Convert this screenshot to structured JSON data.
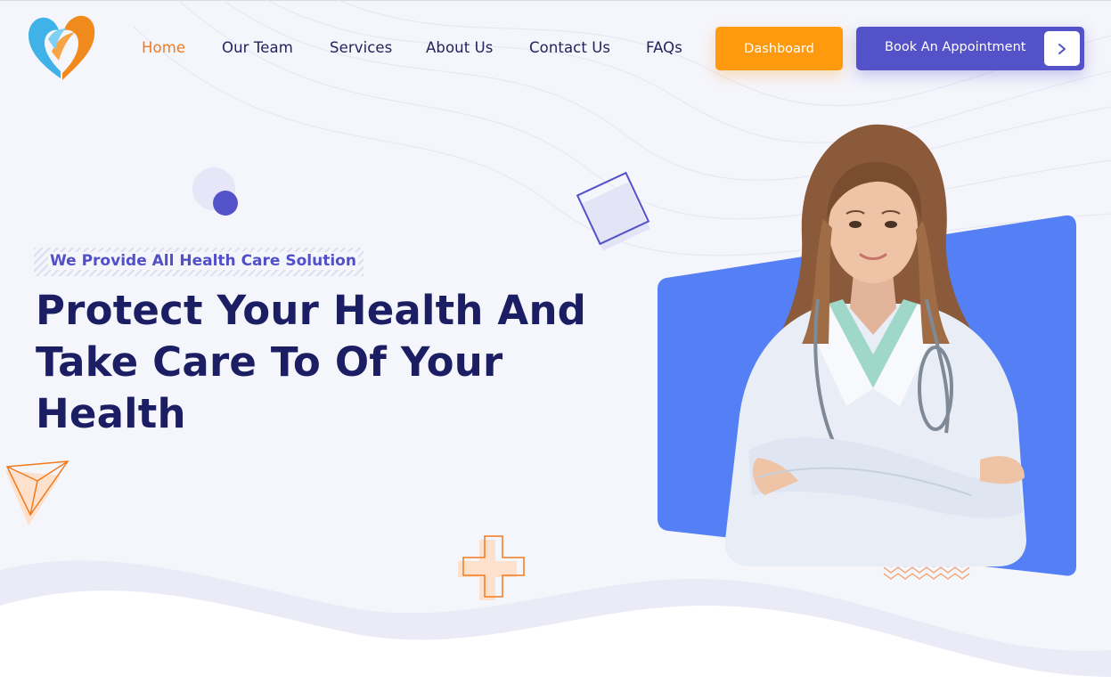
{
  "brand": {
    "logo_icon": "heart-logo-icon",
    "colors": {
      "blue": "#3fb3e8",
      "orange": "#f08a1c"
    }
  },
  "nav": {
    "items": [
      {
        "label": "Home",
        "active": true
      },
      {
        "label": "Our Team",
        "active": false
      },
      {
        "label": "Services",
        "active": false
      },
      {
        "label": "About Us",
        "active": false
      },
      {
        "label": "Contact Us",
        "active": false
      },
      {
        "label": "FAQs",
        "active": false
      }
    ]
  },
  "actions": {
    "dashboard_label": "Dashboard",
    "book_label": "Book An Appointment",
    "book_icon": "chevron-right-icon"
  },
  "hero": {
    "tagline": "We Provide All Health Care Solution",
    "title_line1": "Protect Your Health And",
    "title_line2": "Take Care To Of Your",
    "title_line3": "Health",
    "image": "doctor-portrait"
  },
  "colors": {
    "primary": "#5452c9",
    "accent": "#ff9a0f",
    "heading": "#1c1e64",
    "nav_active": "#f07a1f",
    "card": "#5580f5",
    "background": "#f5f5fc"
  }
}
